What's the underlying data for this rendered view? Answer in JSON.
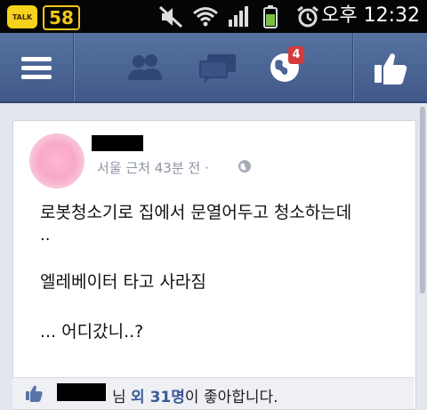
{
  "statusbar": {
    "talk_icon_text": "TALK",
    "badge_count": "58",
    "time": "오후 12:32"
  },
  "navbar": {
    "items": [
      {
        "name": "menu-icon"
      },
      {
        "name": "friend-requests-icon"
      },
      {
        "name": "messages-icon"
      },
      {
        "name": "notifications-globe-icon",
        "badge": "4"
      },
      {
        "name": "like-thumb-icon"
      }
    ]
  },
  "post": {
    "meta_text": "서울 근처 43분 전 ·",
    "lines": [
      "로봇청소기로 집에서 문열어두고 청소하는데",
      "..",
      "엘레베이터 타고 사라짐",
      "... 어디갔니..?"
    ]
  },
  "likes": {
    "suffix_nim": "님 ",
    "and_others": "외 31명",
    "likes_this": "이 좋아합니다."
  },
  "colors": {
    "navbar": "#4b6595",
    "accent_link": "#3b5998",
    "notif_badge": "#d43b3b",
    "status_badge": "#f3c81a"
  }
}
